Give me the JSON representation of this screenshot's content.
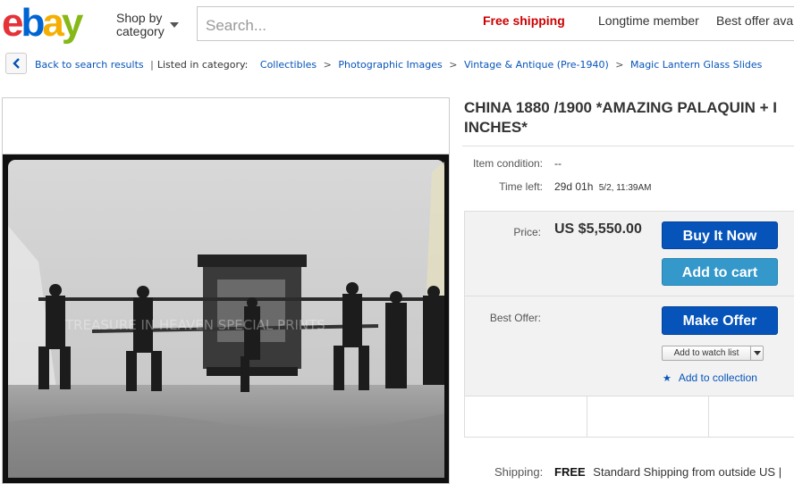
{
  "header": {
    "logo_letters": [
      "e",
      "b",
      "a",
      "y"
    ],
    "logo_colors": [
      "#e53238",
      "#0064d2",
      "#f5af02",
      "#86b817"
    ],
    "shop_by_line1": "Shop by",
    "shop_by_line2": "category",
    "search_placeholder": "Search..."
  },
  "breadcrumb": {
    "back": "Back to search results",
    "listed": "Listed in category:",
    "categories": [
      "Collectibles",
      "Photographic Images",
      "Vintage & Antique (Pre-1940)",
      "Magic Lantern Glass Slides"
    ],
    "separator": ">"
  },
  "photo": {
    "watermark": "TREASURE IN HEAVEN SPECIAL PRINTS"
  },
  "listing": {
    "title_line1": "CHINA 1880 /1900 *AMAZING PALAQUIN + I",
    "title_line2": "INCHES*",
    "condition_label": "Item condition:",
    "condition_value": "--",
    "time_label": "Time left:",
    "time_value": "29d 01h",
    "time_detail": "5/2, 11:39AM"
  },
  "purchase": {
    "price_label": "Price:",
    "price_value": "US $5,550.00",
    "buy_now": "Buy It Now",
    "add_to_cart": "Add to cart",
    "best_offer_label": "Best Offer:",
    "make_offer": "Make Offer",
    "watch_list": "Add to watch list",
    "add_collection": "Add to collection"
  },
  "badges": {
    "free_shipping": "Free shipping",
    "longtime": "Longtime member",
    "best_offer": "Best offer ava"
  },
  "shipping": {
    "label": "Shipping:",
    "free": "FREE",
    "detail": "Standard Shipping from outside US |"
  },
  "colors": {
    "link": "#0654ba",
    "button_primary": "#0654ba",
    "button_secondary": "#3498ca",
    "free_shipping": "#cc0000"
  }
}
